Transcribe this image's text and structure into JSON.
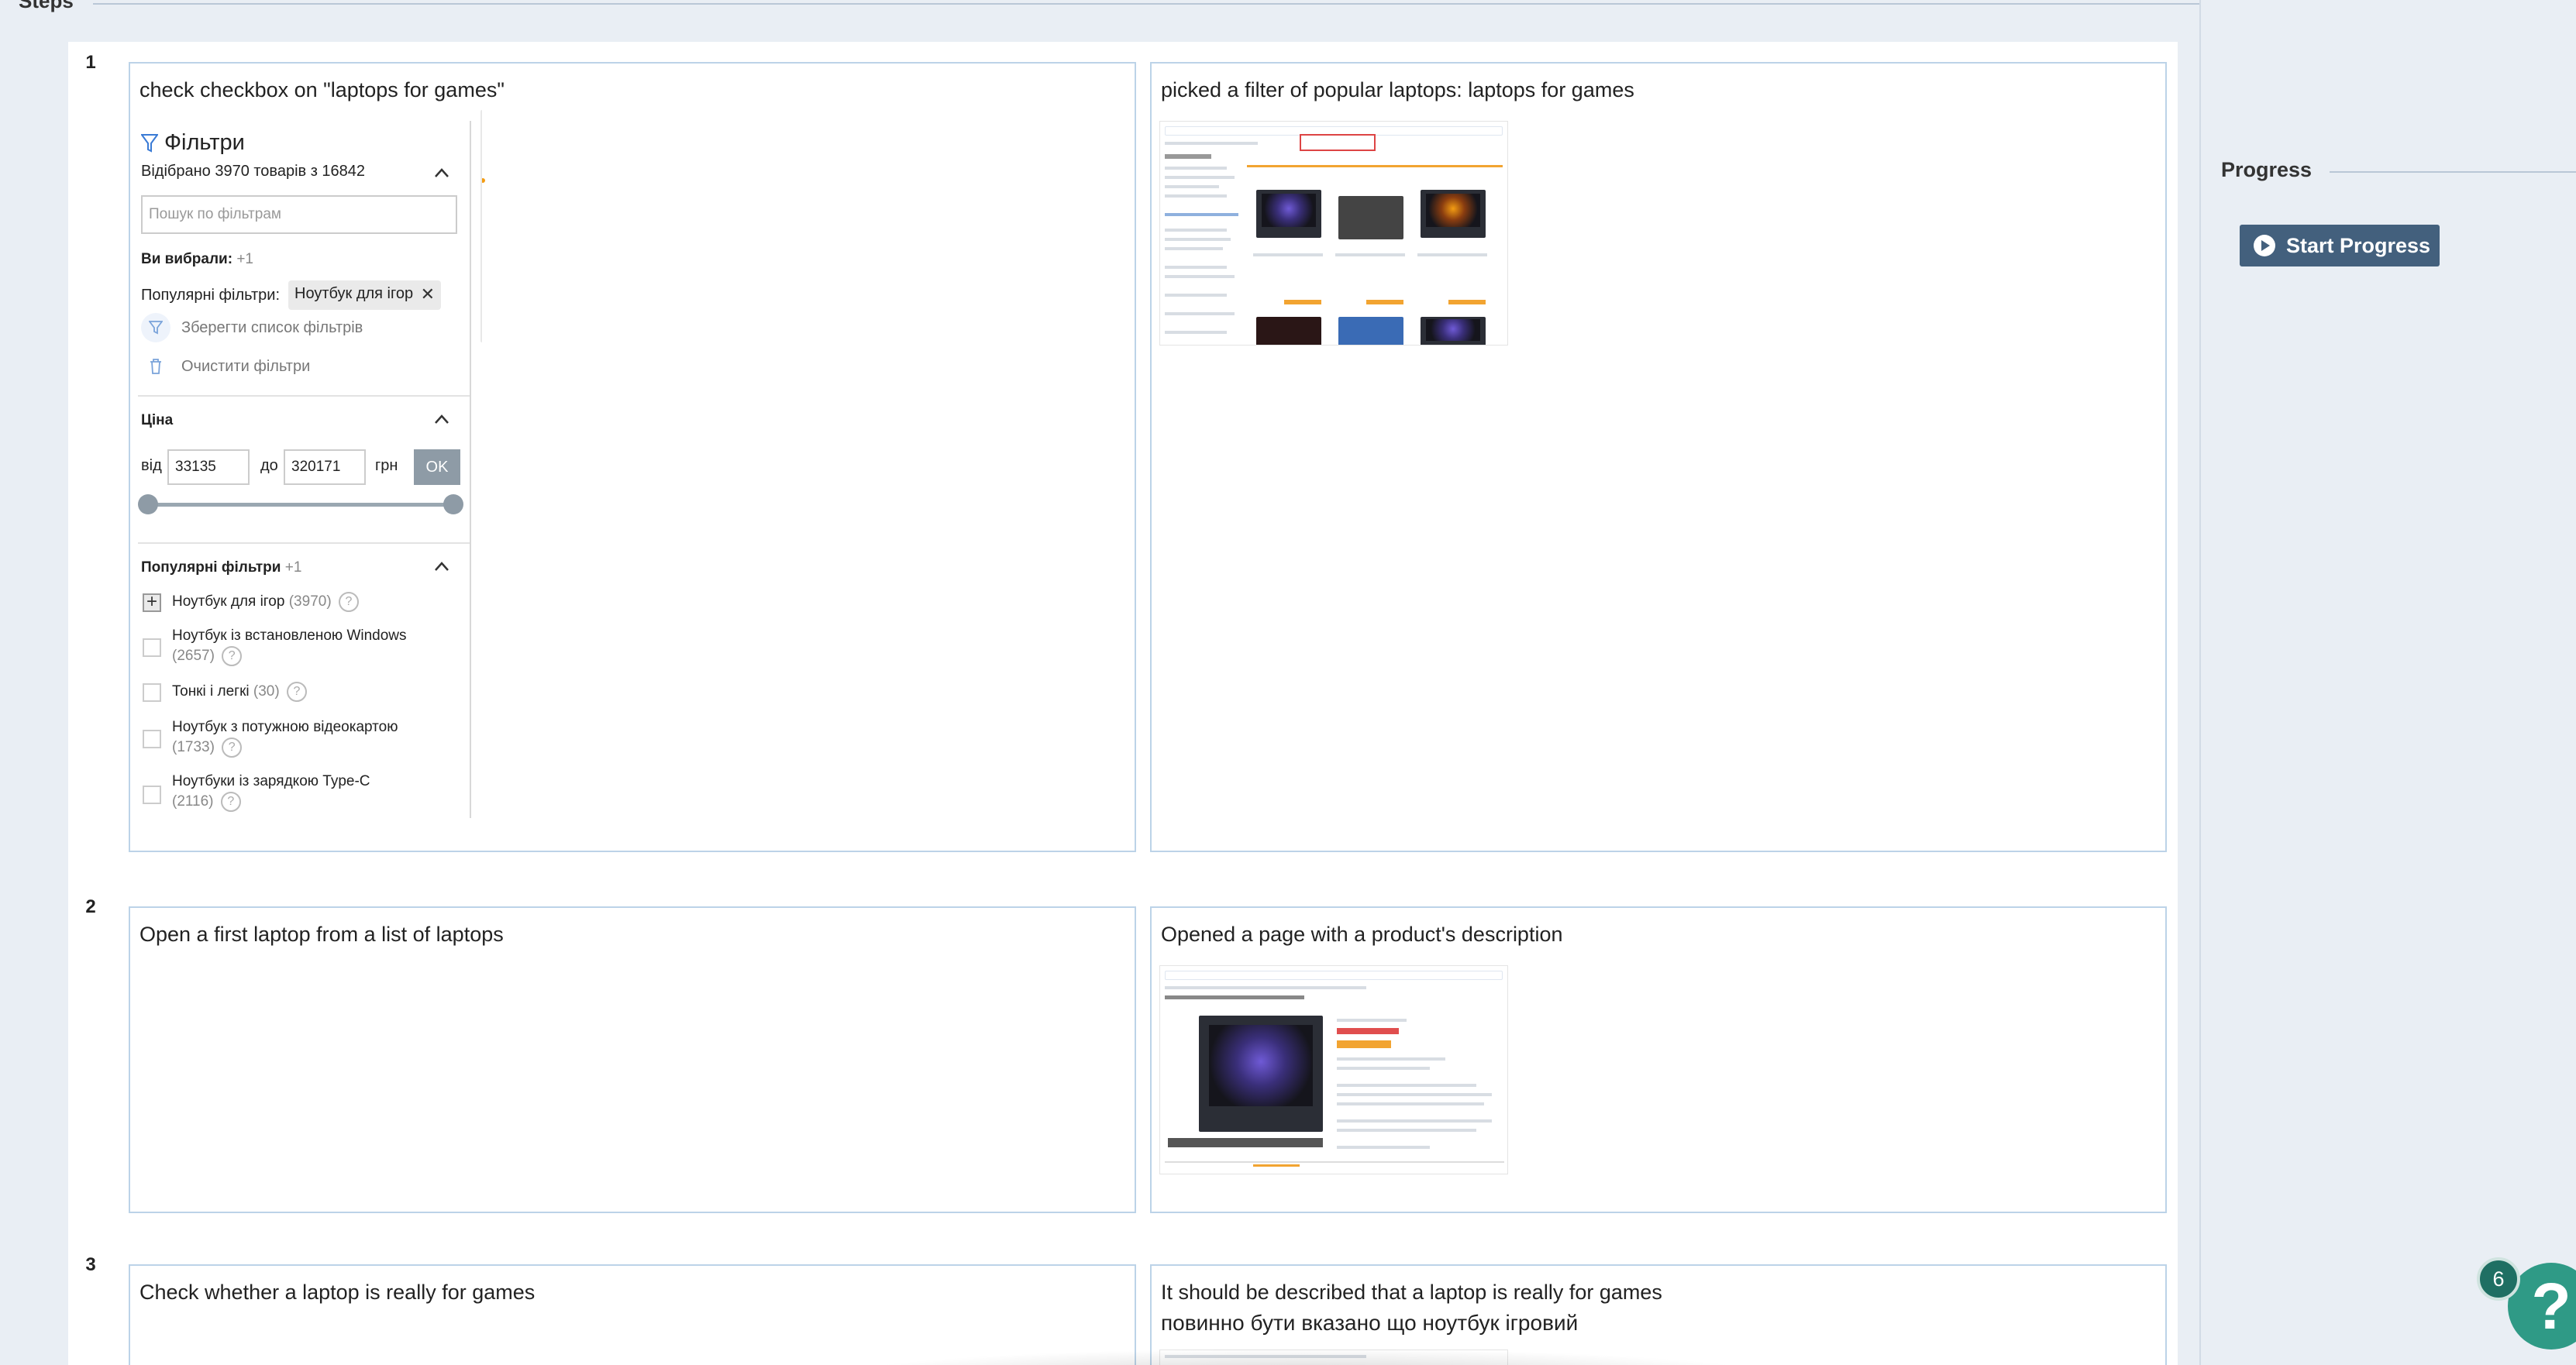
{
  "header": {
    "title": "Steps"
  },
  "steps": [
    {
      "number": "1",
      "action": "check checkbox on \"laptops for games\"",
      "result": "picked a filter of popular laptops: laptops for games",
      "filter_panel": {
        "title": "Фільтри",
        "count_text": "Відібрано 3970 товарів з 16842",
        "search_placeholder": "Пошук по фільтрам",
        "selected_label": "Ви вибрали:",
        "selected_count": "+1",
        "popular_label": "Популярні фільтри:",
        "chip": "Ноутбук для ігор",
        "save_list": "Зберегти список фільтрів",
        "clear_filters": "Очистити фільтри",
        "price_section": "Ціна",
        "from_label": "від",
        "from_value": "33135",
        "to_label": "до",
        "to_value": "320171",
        "currency": "грн",
        "ok": "OK",
        "popular_section": "Популярні фільтри",
        "popular_count": "+1",
        "items": [
          {
            "label": "Ноутбук для ігор",
            "count": "(3970)",
            "checked": true
          },
          {
            "label": "Ноутбук із встановленою Windows",
            "count": "(2657)",
            "checked": false
          },
          {
            "label": "Тонкі і легкі",
            "count": "(30)",
            "checked": false
          },
          {
            "label": "Ноутбук з потужною відеокартою",
            "count": "(1733)",
            "checked": false
          },
          {
            "label": "Ноутбуки із зарядкою Type-C",
            "count": "(2116)",
            "checked": false
          }
        ]
      }
    },
    {
      "number": "2",
      "action": "Open a first laptop from a list of laptops",
      "result": "Opened a page with a product's description"
    },
    {
      "number": "3",
      "action": "Check whether a laptop is really for games",
      "result": "It should be described that a laptop is really for games",
      "result_line2": "повинно бути вказано що ноутбук ігровий"
    }
  ],
  "progress": {
    "title": "Progress",
    "start_label": "Start Progress"
  },
  "help": {
    "badge_count": "6",
    "icon": "?"
  },
  "colors": {
    "accent": "#43607d",
    "help": "#2f9a86",
    "card_border": "#bcd3e8",
    "background": "#e9eef4"
  }
}
